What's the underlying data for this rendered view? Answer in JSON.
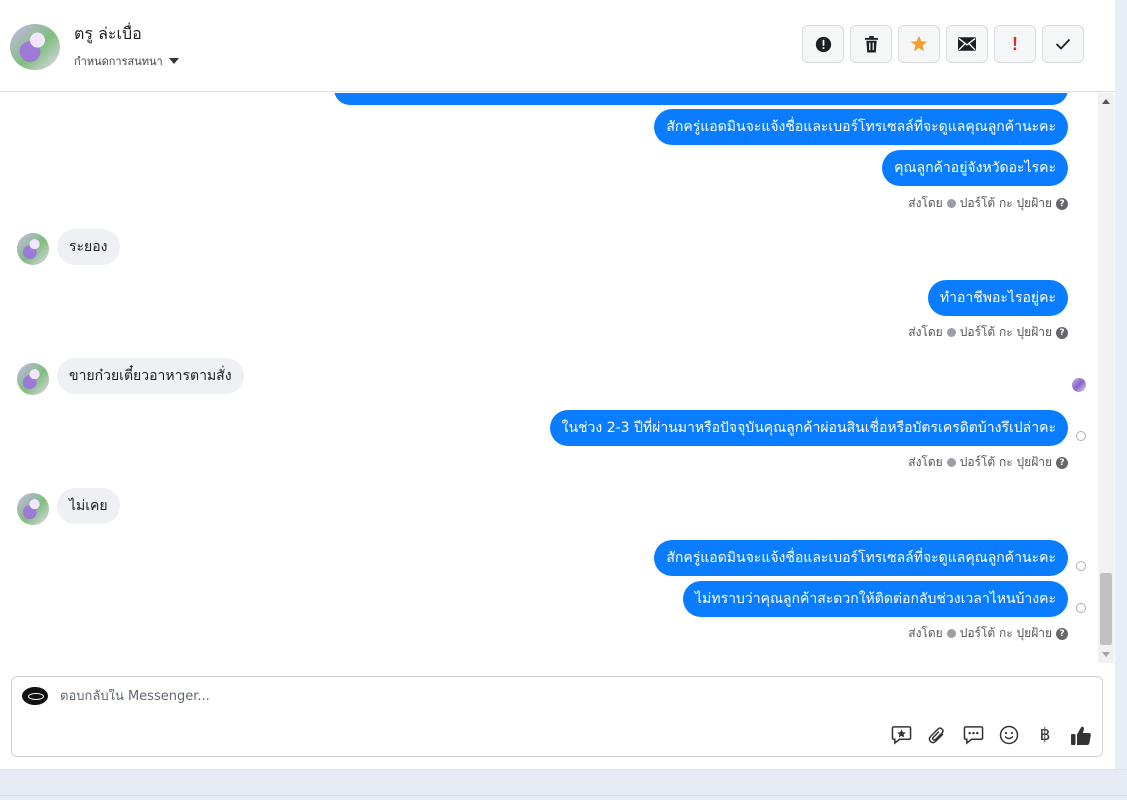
{
  "header": {
    "contact_name": "ตรู ล่ะเบื่อ",
    "conversation_settings": "กำหนดการสนทนา"
  },
  "toolbar": {
    "buttons": [
      {
        "icon": "alert-circle-icon"
      },
      {
        "icon": "trash-icon"
      },
      {
        "icon": "star-icon",
        "color": "#f0a02f"
      },
      {
        "icon": "envelope-icon"
      },
      {
        "icon": "exclamation-icon",
        "color": "#e02b1d",
        "glyph": "!"
      },
      {
        "icon": "checkmark-icon"
      }
    ]
  },
  "messages": {
    "out_1": "สักครู่แอดมินจะแจ้งชื่อและเบอร์โทรเซลล์ที่จะดูแลคุณลูกค้านะคะ",
    "out_2": "คุณลูกค้าอยู่จังหวัดอะไรคะ",
    "sent_by_1": "ส่งโดย",
    "agent_1": "ปอร์โต้ กะ ปุยฝ้าย",
    "in_1": "ระยอง",
    "out_3": "ทำอาชีพอะไรอยู่คะ",
    "sent_by_2": "ส่งโดย",
    "agent_2": "ปอร์โต้ กะ ปุยฝ้าย",
    "in_2": "ขายก๋วยเตี๋ยวอาหารตามสั่ง",
    "out_4": "ในช่วง 2-3 ปีที่ผ่านมาหรือปัจจุบันคุณลูกค้าผ่อนสินเชื่อหรือบัตรเครดิตบ้างรึเปล่าคะ",
    "sent_by_3": "ส่งโดย",
    "agent_3": "ปอร์โต้ กะ ปุยฝ้าย",
    "in_3": "ไม่เคย",
    "out_5": "สักครู่แอดมินจะแจ้งชื่อและเบอร์โทรเซลล์ที่จะดูแลคุณลูกค้านะคะ",
    "out_6": "ไม่ทราบว่าคุณลูกค้าสะดวกให้ติดต่อกลับช่วงเวลาไหนบ้างคะ",
    "sent_by_4": "ส่งโดย",
    "agent_4": "ปอร์โต้ กะ ปุยฝ้าย",
    "help_glyph": "?"
  },
  "composer": {
    "placeholder": "ตอบกลับใน Messenger...",
    "value": "",
    "tools": [
      "saved-reply-icon",
      "paperclip-icon",
      "chat-bubbles-icon",
      "smiley-icon",
      "baht-icon",
      "thumbs-up-icon"
    ],
    "baht_glyph": "฿"
  },
  "colors": {
    "outgoing_bubble": "#0a7cff",
    "incoming_bubble": "#eef0f3",
    "star": "#f0a02f",
    "urgent": "#e02b1d"
  }
}
